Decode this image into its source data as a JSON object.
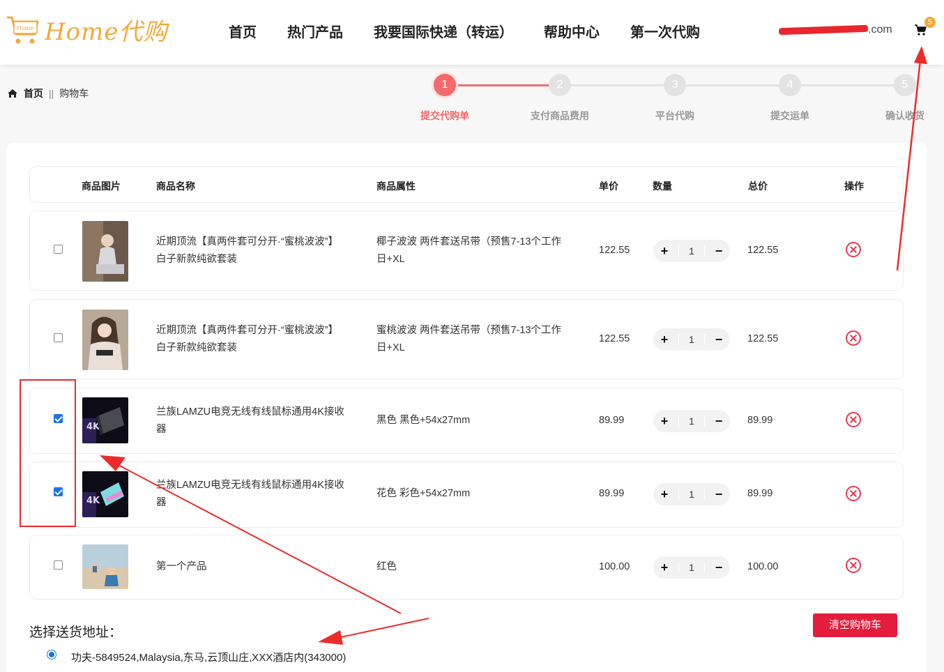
{
  "header": {
    "logo_badge": "Home",
    "logo_text": "Home代购",
    "nav": [
      "首页",
      "热门产品",
      "我要国际快递（转运）",
      "帮助中心",
      "第一次代购"
    ],
    "user_email_tail": ".com",
    "cart_count": "5"
  },
  "breadcrumb": {
    "home": "首页",
    "separator": "||",
    "current": "购物车"
  },
  "steps": [
    {
      "num": "1",
      "label": "提交代购单",
      "active": true
    },
    {
      "num": "2",
      "label": "支付商品费用",
      "active": false
    },
    {
      "num": "3",
      "label": "平台代购",
      "active": false
    },
    {
      "num": "4",
      "label": "提交运单",
      "active": false
    },
    {
      "num": "5",
      "label": "确认收货",
      "active": false
    }
  ],
  "table": {
    "headers": {
      "image": "商品图片",
      "name": "商品名称",
      "attrs": "商品属性",
      "price": "单价",
      "qty": "数量",
      "total": "总价",
      "action": "操作"
    },
    "rows": [
      {
        "checked": false,
        "image": "product-photo-woman-1",
        "name1": "近期顶流【真两件套可分开·“蜜桃波波”】",
        "name2": "白子新款纯欲套装",
        "attr1": "椰子波波 两件套送吊带（预售7-13个工作",
        "attr2": "日+XL",
        "price": "122.55",
        "qty": "1",
        "total": "122.55"
      },
      {
        "checked": false,
        "image": "product-photo-woman-2",
        "name1": "近期顶流【真两件套可分开·“蜜桃波波”】",
        "name2": "白子新款纯欲套装",
        "attr1": "蜜桃波波 两件套送吊带（预售7-13个工作",
        "attr2": "日+XL",
        "price": "122.55",
        "qty": "1",
        "total": "122.55"
      },
      {
        "checked": true,
        "image": "product-photo-lamzu-dongle-black",
        "name1": "兰族LAMZU电竞无线有线鼠标通用4K接收",
        "name2": "器",
        "attr1": "黑色 黑色+54x27mm",
        "attr2": "",
        "price": "89.99",
        "qty": "1",
        "total": "89.99"
      },
      {
        "checked": true,
        "image": "product-photo-lamzu-dongle-color",
        "name1": "兰族LAMZU电竞无线有线鼠标通用4K接收",
        "name2": "器",
        "attr1": "花色 彩色+54x27mm",
        "attr2": "",
        "price": "89.99",
        "qty": "1",
        "total": "89.99"
      },
      {
        "checked": false,
        "image": "product-photo-child-beach",
        "name1": "第一个产品",
        "name2": "",
        "attr1": "红色",
        "attr2": "",
        "price": "100.00",
        "qty": "1",
        "total": "100.00"
      }
    ]
  },
  "address": {
    "title": "选择送货地址：",
    "option": "功夫-5849524,Malaysia,东马,云顶山庄,XXX酒店内(343000)"
  },
  "clear_cart_label": "清空购物车",
  "colors": {
    "accent": "#f36a6a",
    "brand": "#f2a93b",
    "danger": "#e31d3b",
    "annotation": "#ee2b2b"
  }
}
